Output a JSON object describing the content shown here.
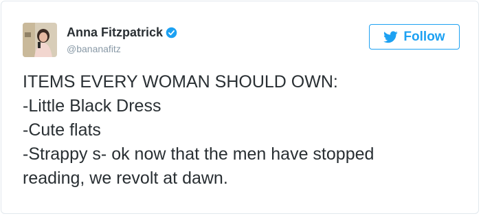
{
  "author": {
    "display_name": "Anna Fitzpatrick",
    "handle": "@bananafitz",
    "verified": true,
    "avatar_icon": "profile-photo"
  },
  "follow_button": {
    "label": "Follow",
    "icon": "twitter-bird-icon"
  },
  "tweet": {
    "lines": [
      "ITEMS EVERY WOMAN SHOULD OWN:",
      "-Little Black Dress",
      "-Cute flats",
      "-Strappy s- ok now that the men have stopped",
      "reading, we revolt at dawn."
    ]
  },
  "colors": {
    "accent": "#1da1f2",
    "text": "#292f33",
    "muted": "#8899a6",
    "border": "#e1e8ed"
  }
}
